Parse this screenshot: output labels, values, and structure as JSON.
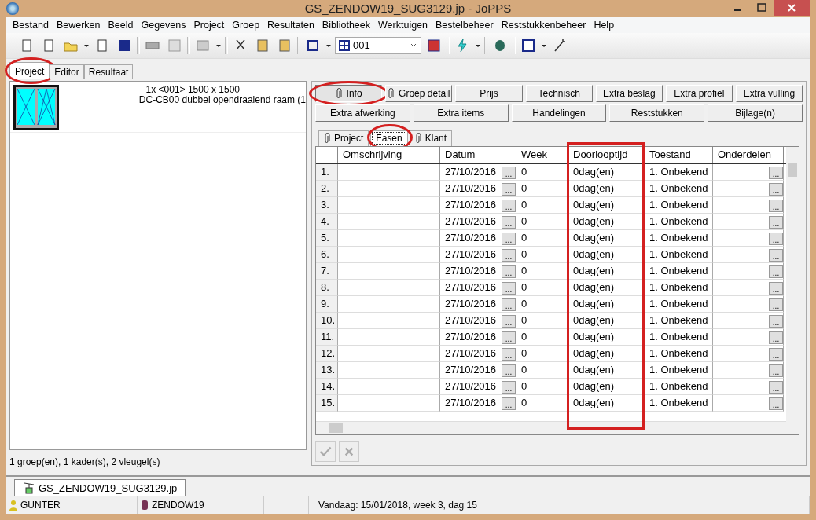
{
  "window": {
    "title": "GS_ZENDOW19_SUG3129.jp - JoPPS"
  },
  "menu": [
    "Bestand",
    "Bewerken",
    "Beeld",
    "Gegevens",
    "Project",
    "Groep",
    "Resultaten",
    "Bibliotheek",
    "Werktuigen",
    "Bestelbeheer",
    "Reststukkenbeheer",
    "Help"
  ],
  "toolbar": {
    "combo_value": "001"
  },
  "main_tabs": [
    {
      "label": "Project",
      "selected": true,
      "circled": true
    },
    {
      "label": "Editor",
      "selected": false,
      "circled": false
    },
    {
      "label": "Resultaat",
      "selected": false,
      "circled": false
    }
  ],
  "project_item": {
    "line_1": "1x <001> 1500 x 1500",
    "line_2": "DC-CB00 dubbel opendraaiend raam (1"
  },
  "left_status": "1 groep(en), 1 kader(s), 2 vleugel(s)",
  "detail_buttons": [
    [
      {
        "label": "Info",
        "clip": true,
        "pressed": true,
        "circled": true
      },
      {
        "label": "Groep detail",
        "clip": true,
        "pressed": false,
        "circled": false
      },
      {
        "label": "Prijs",
        "clip": false,
        "pressed": false,
        "circled": false
      },
      {
        "label": "Technisch",
        "clip": false,
        "pressed": false,
        "circled": false
      },
      {
        "label": "Extra beslag",
        "clip": false,
        "pressed": false,
        "circled": false
      },
      {
        "label": "Extra profiel",
        "clip": false,
        "pressed": false,
        "circled": false
      },
      {
        "label": "Extra vulling",
        "clip": false,
        "pressed": false,
        "circled": false
      }
    ],
    [
      {
        "label": "Extra afwerking",
        "clip": false,
        "pressed": false,
        "circled": false
      },
      {
        "label": "Extra items",
        "clip": false,
        "pressed": false,
        "circled": false
      },
      {
        "label": "Handelingen",
        "clip": false,
        "pressed": false,
        "circled": false
      },
      {
        "label": "Reststukken",
        "clip": false,
        "pressed": false,
        "circled": false
      },
      {
        "label": "Bijlage(n)",
        "clip": false,
        "pressed": false,
        "circled": false
      }
    ]
  ],
  "sub_tabs": [
    {
      "label": "Project",
      "clip": true,
      "selected": false,
      "circled": false
    },
    {
      "label": "Fasen",
      "clip": false,
      "selected": true,
      "circled": true
    },
    {
      "label": "Klant",
      "clip": true,
      "selected": false,
      "circled": false
    }
  ],
  "table": {
    "columns": [
      {
        "label": "Omschrijving",
        "boxed": false
      },
      {
        "label": "Datum",
        "boxed": false
      },
      {
        "label": "Week",
        "boxed": false
      },
      {
        "label": "Doorlooptijd",
        "boxed": true
      },
      {
        "label": "Toestand",
        "boxed": false
      },
      {
        "label": "Onderdelen",
        "boxed": false
      }
    ],
    "rows": [
      {
        "nr": "1.",
        "datum": "27/10/2016",
        "datum_button": "...",
        "onderdelen_button": "...",
        "week": "0",
        "doorlooptijd": "0dag(en)",
        "toestand": "1. Onbekend"
      },
      {
        "nr": "2.",
        "datum": "27/10/2016",
        "datum_button": "...",
        "onderdelen_button": "...",
        "week": "0",
        "doorlooptijd": "0dag(en)",
        "toestand": "1. Onbekend"
      },
      {
        "nr": "3.",
        "datum": "27/10/2016",
        "datum_button": "...",
        "onderdelen_button": "...",
        "week": "0",
        "doorlooptijd": "0dag(en)",
        "toestand": "1. Onbekend"
      },
      {
        "nr": "4.",
        "datum": "27/10/2016",
        "datum_button": "...",
        "onderdelen_button": "...",
        "week": "0",
        "doorlooptijd": "0dag(en)",
        "toestand": "1. Onbekend"
      },
      {
        "nr": "5.",
        "datum": "27/10/2016",
        "datum_button": "...",
        "onderdelen_button": "...",
        "week": "0",
        "doorlooptijd": "0dag(en)",
        "toestand": "1. Onbekend"
      },
      {
        "nr": "6.",
        "datum": "27/10/2016",
        "datum_button": "...",
        "onderdelen_button": "...",
        "week": "0",
        "doorlooptijd": "0dag(en)",
        "toestand": "1. Onbekend"
      },
      {
        "nr": "7.",
        "datum": "27/10/2016",
        "datum_button": "...",
        "onderdelen_button": "...",
        "week": "0",
        "doorlooptijd": "0dag(en)",
        "toestand": "1. Onbekend"
      },
      {
        "nr": "8.",
        "datum": "27/10/2016",
        "datum_button": "...",
        "onderdelen_button": "...",
        "week": "0",
        "doorlooptijd": "0dag(en)",
        "toestand": "1. Onbekend"
      },
      {
        "nr": "9.",
        "datum": "27/10/2016",
        "datum_button": "...",
        "onderdelen_button": "...",
        "week": "0",
        "doorlooptijd": "0dag(en)",
        "toestand": "1. Onbekend"
      },
      {
        "nr": "10.",
        "datum": "27/10/2016",
        "datum_button": "...",
        "onderdelen_button": "...",
        "week": "0",
        "doorlooptijd": "0dag(en)",
        "toestand": "1. Onbekend"
      },
      {
        "nr": "11.",
        "datum": "27/10/2016",
        "datum_button": "...",
        "onderdelen_button": "...",
        "week": "0",
        "doorlooptijd": "0dag(en)",
        "toestand": "1. Onbekend"
      },
      {
        "nr": "12.",
        "datum": "27/10/2016",
        "datum_button": "...",
        "onderdelen_button": "...",
        "week": "0",
        "doorlooptijd": "0dag(en)",
        "toestand": "1. Onbekend"
      },
      {
        "nr": "13.",
        "datum": "27/10/2016",
        "datum_button": "...",
        "onderdelen_button": "...",
        "week": "0",
        "doorlooptijd": "0dag(en)",
        "toestand": "1. Onbekend"
      },
      {
        "nr": "14.",
        "datum": "27/10/2016",
        "datum_button": "...",
        "onderdelen_button": "...",
        "week": "0",
        "doorlooptijd": "0dag(en)",
        "toestand": "1. Onbekend"
      },
      {
        "nr": "15.",
        "datum": "27/10/2016",
        "datum_button": "...",
        "onderdelen_button": "...",
        "week": "0",
        "doorlooptijd": "0dag(en)",
        "toestand": "1. Onbekend"
      }
    ]
  },
  "document_tab": {
    "label": "GS_ZENDOW19_SUG3129.jp"
  },
  "status_bar": {
    "user": "GUNTER",
    "database": "ZENDOW19",
    "today": "Vandaag: 15/01/2018, week 3, dag 15"
  }
}
